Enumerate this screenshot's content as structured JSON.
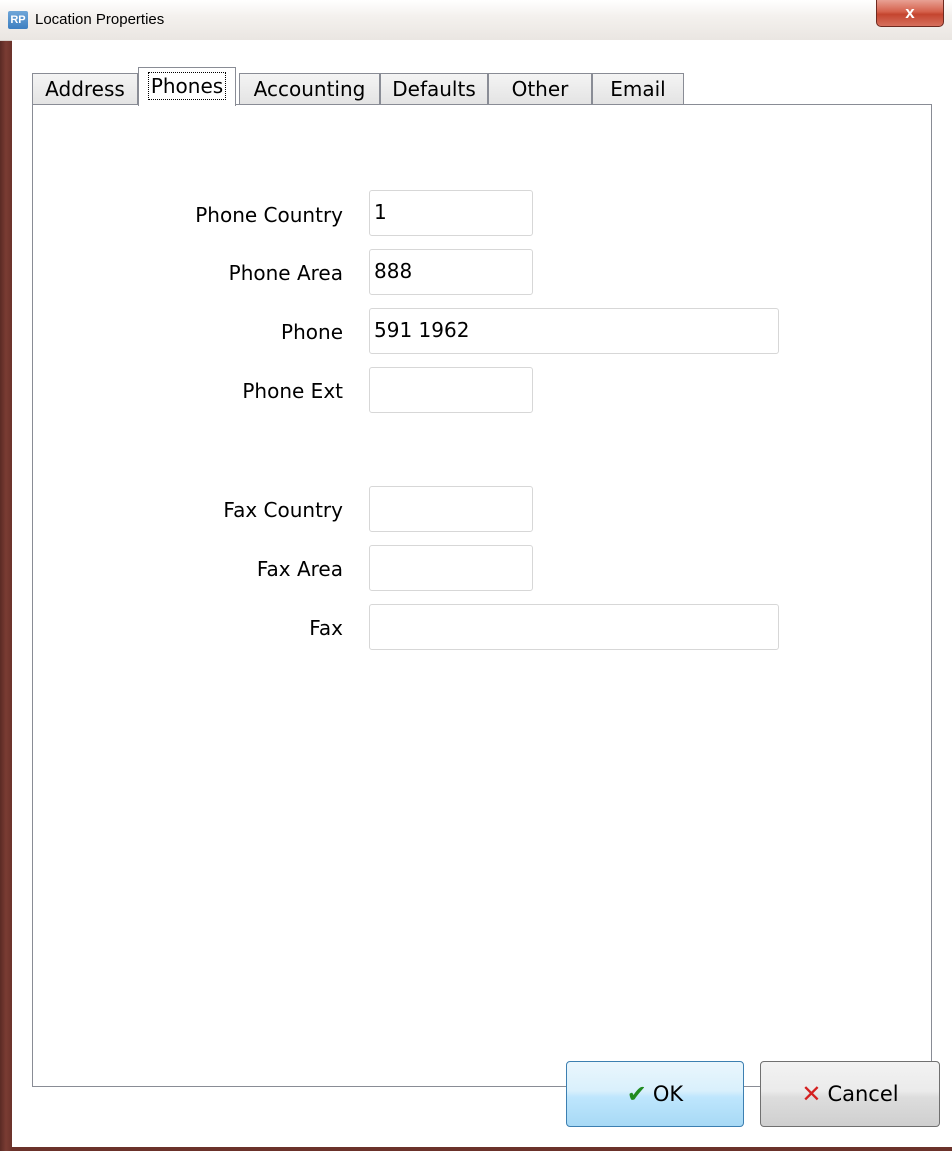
{
  "window": {
    "icon_text": "RP",
    "title": "Location Properties",
    "close_label": "x"
  },
  "tabs": [
    {
      "label": "Address",
      "active": false
    },
    {
      "label": "Phones",
      "active": true
    },
    {
      "label": "Accounting",
      "active": false
    },
    {
      "label": "Defaults",
      "active": false
    },
    {
      "label": "Other",
      "active": false
    },
    {
      "label": "Email",
      "active": false
    }
  ],
  "phones": {
    "phone_country": {
      "label": "Phone Country",
      "value": "1"
    },
    "phone_area": {
      "label": "Phone Area",
      "value": "888"
    },
    "phone": {
      "label": "Phone",
      "value": "591 1962"
    },
    "phone_ext": {
      "label": "Phone Ext",
      "value": ""
    },
    "fax_country": {
      "label": "Fax Country",
      "value": ""
    },
    "fax_area": {
      "label": "Fax Area",
      "value": ""
    },
    "fax": {
      "label": "Fax",
      "value": ""
    }
  },
  "buttons": {
    "ok_label": "OK",
    "cancel_label": "Cancel"
  },
  "colors": {
    "ok_icon": "#1f8b1f",
    "cancel_icon": "#d42020",
    "close_button": "#c4452f"
  }
}
